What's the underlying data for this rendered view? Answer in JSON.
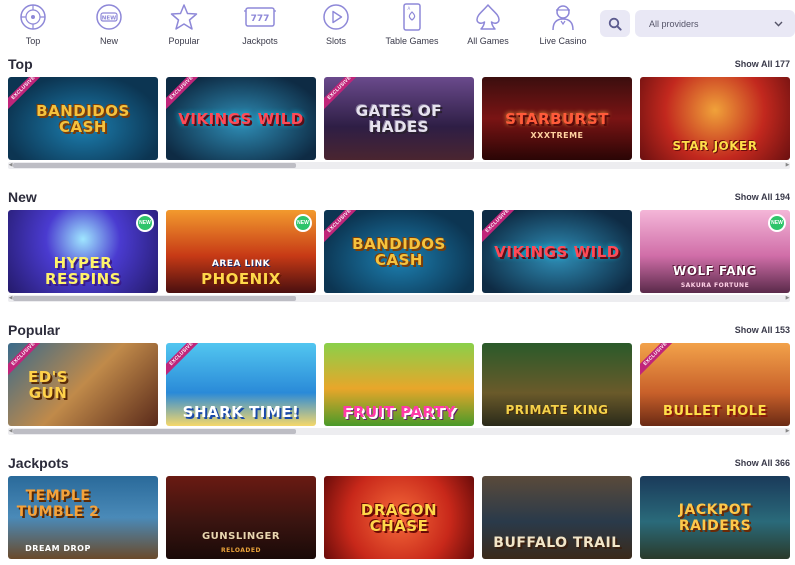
{
  "nav": {
    "categories": [
      {
        "label": "Top",
        "icon": "roulette-icon"
      },
      {
        "label": "New",
        "icon": "new-badge-icon"
      },
      {
        "label": "Popular",
        "icon": "star-icon"
      },
      {
        "label": "Jackpots",
        "icon": "slot-777-icon"
      },
      {
        "label": "Slots",
        "icon": "play-icon"
      },
      {
        "label": "Table Games",
        "icon": "playing-card-icon"
      },
      {
        "label": "All Games",
        "icon": "spade-icon"
      },
      {
        "label": "Live Casino",
        "icon": "dealer-icon"
      }
    ],
    "provider_label": "All providers"
  },
  "sections": [
    {
      "title": "Top",
      "show_all": "Show All",
      "count": "177",
      "games": [
        {
          "name": "Bandidos Cash",
          "ribbon": "EXCLUSIVE",
          "sub": ""
        },
        {
          "name": "Vikings Wild",
          "ribbon": "EXCLUSIVE",
          "sub": ""
        },
        {
          "name": "Gates of Hades",
          "ribbon": "EXCLUSIVE",
          "sub": ""
        },
        {
          "name": "Starburst",
          "ribbon": "",
          "sub": "XXXTREME"
        },
        {
          "name": "Star Joker",
          "ribbon": "",
          "sub": ""
        }
      ]
    },
    {
      "title": "New",
      "show_all": "Show All",
      "count": "194",
      "games": [
        {
          "name": "Hyper Respins",
          "ribbon": "",
          "sub": "",
          "badge": "NEW"
        },
        {
          "name": "Phoenix",
          "ribbon": "",
          "sub": "AREA LINK",
          "badge": "NEW"
        },
        {
          "name": "Bandidos Cash",
          "ribbon": "EXCLUSIVE",
          "sub": ""
        },
        {
          "name": "Vikings Wild",
          "ribbon": "EXCLUSIVE",
          "sub": ""
        },
        {
          "name": "Wolf Fang",
          "ribbon": "",
          "sub": "SAKURA FORTUNE",
          "badge": "NEW"
        }
      ]
    },
    {
      "title": "Popular",
      "show_all": "Show All",
      "count": "153",
      "games": [
        {
          "name": "Ed's Gun",
          "ribbon": "EXCLUSIVE",
          "sub": ""
        },
        {
          "name": "Shark Time!",
          "ribbon": "EXCLUSIVE",
          "sub": ""
        },
        {
          "name": "Fruit Party",
          "ribbon": "",
          "sub": ""
        },
        {
          "name": "Primate King",
          "ribbon": "",
          "sub": ""
        },
        {
          "name": "Bullet Hole",
          "ribbon": "EXCLUSIVE",
          "sub": ""
        }
      ]
    },
    {
      "title": "Jackpots",
      "show_all": "Show All",
      "count": "366",
      "games": [
        {
          "name": "Temple Tumble 2",
          "ribbon": "",
          "sub": "DREAM DROP"
        },
        {
          "name": "Gunslinger",
          "ribbon": "",
          "sub": "RELOADED"
        },
        {
          "name": "Dragon Chase",
          "ribbon": "",
          "sub": ""
        },
        {
          "name": "Buffalo Trail",
          "ribbon": "",
          "sub": ""
        },
        {
          "name": "Jackpot Raiders",
          "ribbon": "",
          "sub": ""
        }
      ]
    }
  ],
  "colors": {
    "accent": "#7b6fd6",
    "ribbon": "#c0257a",
    "new_badge": "#2ec46a",
    "nav_icon": "#8e88d8"
  }
}
